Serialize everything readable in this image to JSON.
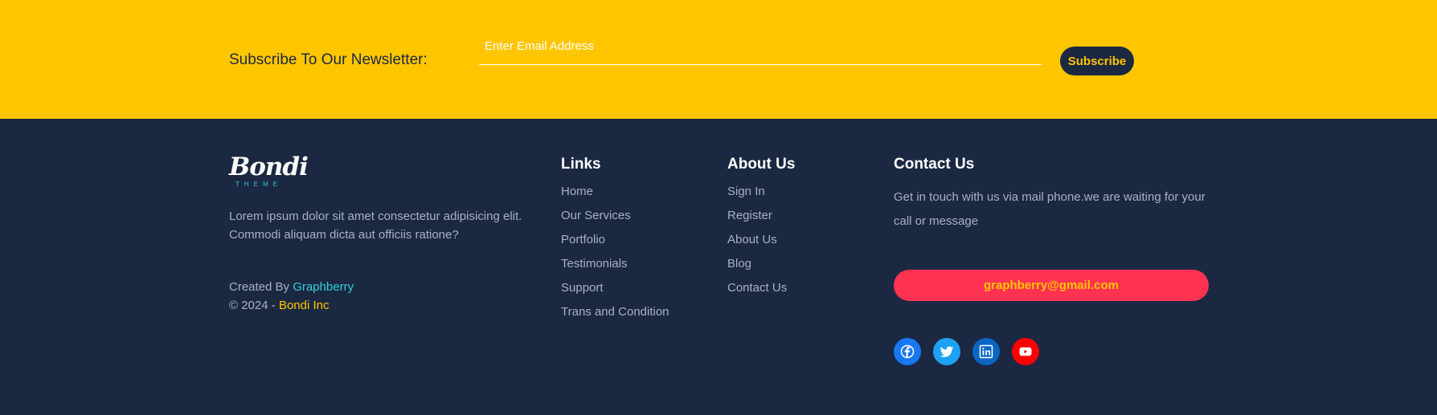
{
  "newsletter": {
    "title": "Subscribe To Our Newsletter:",
    "email_placeholder": "Enter Email Address",
    "subscribe_label": "Subscribe"
  },
  "brand": {
    "logo_text": "Bondi",
    "logo_subtext": "THEME",
    "description": "Lorem ipsum dolor sit amet consectetur adipisicing elit. Commodi aliquam dicta aut officiis ratione?",
    "created_by_prefix": "Created By",
    "created_by_name": "Graphberry",
    "copyright_prefix": "© 2024 -",
    "copyright_name": "Bondi Inc"
  },
  "links_column": {
    "title": "Links",
    "items": [
      "Home",
      "Our Services",
      "Portfolio",
      "Testimonials",
      "Support",
      "Trans and Condition"
    ]
  },
  "about_column": {
    "title": "About Us",
    "items": [
      "Sign In",
      "Register",
      "About Us",
      "Blog",
      "Contact Us"
    ]
  },
  "contact_column": {
    "title": "Contact Us",
    "text": "Get in touch with us via mail phone.we are waiting for your call or message",
    "email": "graphberry@gmail.com"
  },
  "socials": [
    {
      "icon": "facebook-icon",
      "color": "#1877f2"
    },
    {
      "icon": "twitter-icon",
      "color": "#1da1f2"
    },
    {
      "icon": "linkedin-icon",
      "color": "#0a66c2"
    },
    {
      "icon": "youtube-icon",
      "color": "#ff0000"
    }
  ],
  "colors": {
    "accent": "#ffc600",
    "footer_bg": "#1b2841",
    "email_pill": "#ff3252",
    "link_teal": "#2fd1dd"
  }
}
